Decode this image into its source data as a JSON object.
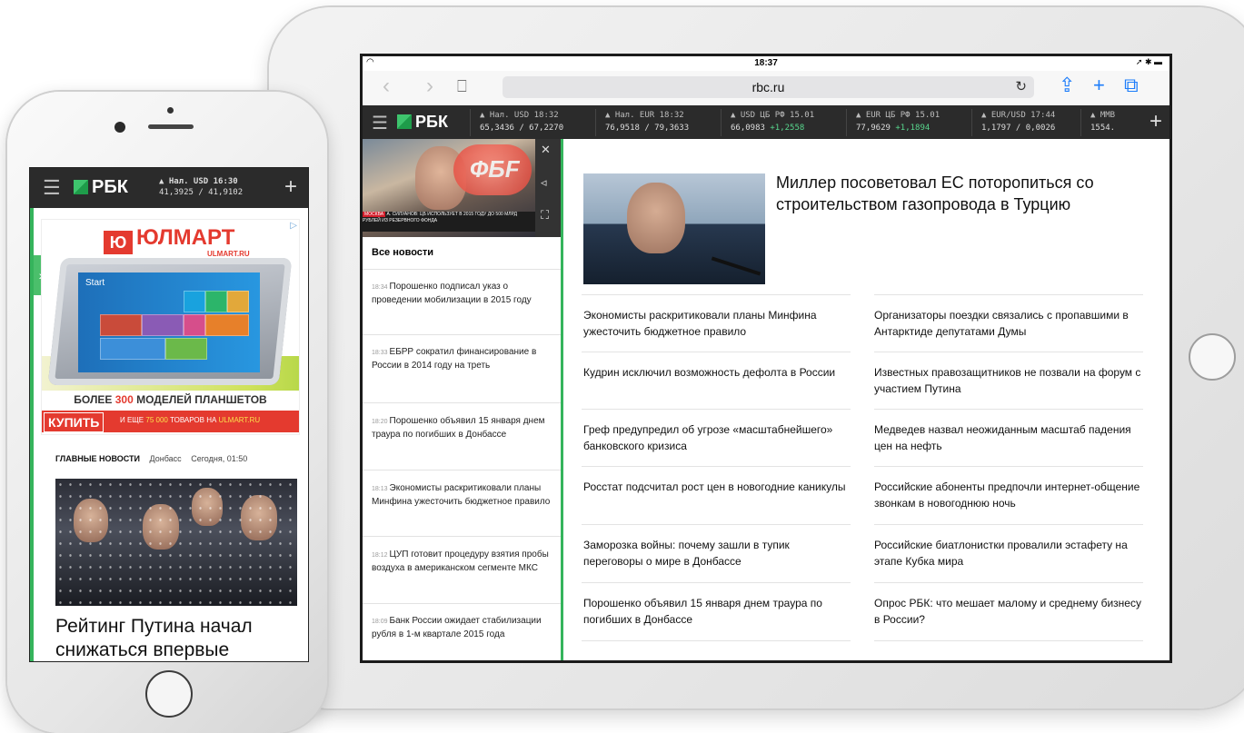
{
  "tablet": {
    "status": {
      "time": "18:37",
      "wifi_icon": "wifi-icon",
      "battery_icon": "battery-icon"
    },
    "browser": {
      "url": "rbc.ru"
    },
    "rbc_header": {
      "logo_text": "РБК",
      "tickers": [
        {
          "line1": "▲ Нал. USD 18:32",
          "line2": "65,3436 / 67,2270",
          "change": ""
        },
        {
          "line1": "▲ Нал. EUR 18:32",
          "line2": "76,9518 / 79,3633",
          "change": ""
        },
        {
          "line1": "▲ USD ЦБ РФ 15.01",
          "line2": "66,0983",
          "change": "+1,2558"
        },
        {
          "line1": "▲ EUR ЦБ РФ 15.01",
          "line2": "77,9629",
          "change": "+1,1894"
        },
        {
          "line1": "▲ EUR/USD 17:44",
          "line2": "1,1797 / 0,0026",
          "change": ""
        },
        {
          "line1": "▲ ММВ",
          "line2": "1554.",
          "change": ""
        }
      ]
    },
    "sidebar": {
      "video_caption_badge": "МОСКВА",
      "video_caption_text": "А. СИЛУАНОВ: ЦБ ИСПОЛЬЗУЕТ В 2015 ГОДУ ДО 500 МЛРД РУБЛЕЙ ИЗ РЕЗЕРВНОГО ФОНДА",
      "video_logo": "ФБF",
      "all_news_label": "Все новости",
      "news": [
        {
          "time": "18:34",
          "text": "Порошенко подписал указ о проведении мобилизации в 2015 году"
        },
        {
          "time": "18:33",
          "text": "ЕБРР сократил финансирование в России в 2014 году на треть"
        },
        {
          "time": "18:20",
          "text": "Порошенко объявил 15 января днем траура по погибших в Донбассе"
        },
        {
          "time": "18:13",
          "text": "Экономисты раскритиковали планы Минфина ужесточить бюджетное правило"
        },
        {
          "time": "18:12",
          "text": "ЦУП готовит процедуру взятия пробы воздуха в американском сегменте МКС"
        },
        {
          "time": "18:09",
          "text": "Банк России ожидает стабилизации рубля в 1-м квартале 2015 года"
        }
      ]
    },
    "main": {
      "hero_title": "Миллер посоветовал ЕС поторопиться со строительством газопровода в Турцию",
      "stories_left": [
        "Экономисты раскритиковали планы Минфина ужесточить бюджетное правило",
        "Кудрин исключил возможность дефолта в России",
        "Греф предупредил об угрозе «масштабнейшего» банковского кризиса",
        "Росстат подсчитал рост цен в новогодние каникулы",
        "Заморозка войны: почему зашли в тупик переговоры о мире в Донбассе",
        "Порошенко объявил 15 января днем траура по погибших в Донбассе"
      ],
      "stories_right": [
        "Организаторы поездки связались с пропавшими в Антарктиде депутатами Думы",
        "Известных правозащитников не позвали на форум с участием Путина",
        "Медведев назвал неожиданным масштаб падения цен на нефть",
        "Российские абоненты предпочли интернет-общение звонкам в новогоднюю ночь",
        "Российские биатлонистки провалили эстафету на этапе Кубка мира",
        "Опрос РБК: что мешает малому и среднему бизнесу в России?"
      ]
    }
  },
  "phone": {
    "logo_text": "РБК",
    "ticker": {
      "line1": "▲ Нал. USD 16:30",
      "line2": "41,3925 / 41,9102"
    },
    "ad": {
      "brand": "ЮЛМАРТ",
      "brand_sub": "ULMART.RU",
      "tablet_label": "Start",
      "promo_prefix": "БОЛЕЕ",
      "promo_number": "300",
      "promo_suffix": "МОДЕЛЕЙ ПЛАНШЕТОВ",
      "buy_label": "КУПИТЬ",
      "more_prefix": "И ЕЩЕ",
      "more_count": "75 000",
      "more_mid": "ТОВАРОВ НА",
      "more_site": "ULMART.RU"
    },
    "tabs": {
      "main": "ГЛАВНЫЕ НОВОСТИ",
      "t1": "Донбасс",
      "t2": "Сегодня, 01:50"
    },
    "headline": "Рейтинг Путина начал снижаться впервые"
  },
  "colors": {
    "accent_green": "#35b45c",
    "header_dark": "#2b2b2b",
    "ios_blue": "#1d7dfa",
    "ad_red": "#e43a2f"
  }
}
